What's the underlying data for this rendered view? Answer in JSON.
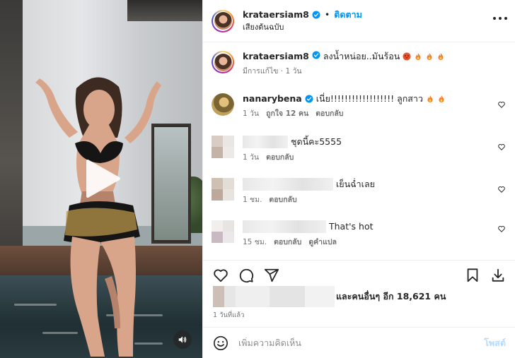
{
  "header": {
    "username": "krataersiam8",
    "separator": "•",
    "follow_label": "ติดตาม",
    "audio_label": "เสียงต้นฉบับ"
  },
  "caption": {
    "username": "krataersiam8",
    "text": "ลงน้ำหน่อย..มันร้อน",
    "edited": "มีการแก้ไข",
    "separator": "·",
    "time": "1 วัน"
  },
  "comments": [
    {
      "username": "nanarybena",
      "text": "เนี่ย!!!!!!!!!!!!!!!!!! ลูกสาว",
      "time": "1 วัน",
      "likes": "ถูกใจ 12 คน",
      "reply": "ตอบกลับ"
    },
    {
      "username": "",
      "text": "ชุดนี้คะ5555",
      "time": "1 วัน",
      "reply": "ตอบกลับ"
    },
    {
      "username": "",
      "text": "เย็นฉ่ำเลย",
      "time": "1 ชม.",
      "reply": "ตอบกลับ"
    },
    {
      "username": "",
      "text": "That's hot",
      "time": "15 ชม.",
      "reply": "ตอบกลับ",
      "translate": "ดูคำแปล"
    }
  ],
  "likes": {
    "text": "และคนอื่นๆ อีก 18,621 คน"
  },
  "date": "1 วันที่แล้ว",
  "add_comment": {
    "placeholder": "เพิ่มความคิดเห็น",
    "post_label": "โพสต์"
  },
  "icons": {
    "play": "play-icon",
    "sound": "speaker-icon",
    "more": "more-icon",
    "verified": "verified-badge-icon",
    "heart": "heart-icon",
    "comment": "comment-icon",
    "share": "share-icon",
    "save": "bookmark-icon",
    "download": "download-icon",
    "emoji": "smiley-icon"
  },
  "colors": {
    "accent": "#0095f6",
    "verified": "#0095f6",
    "post_disabled": "#b3dbff",
    "muted": "#737373"
  }
}
